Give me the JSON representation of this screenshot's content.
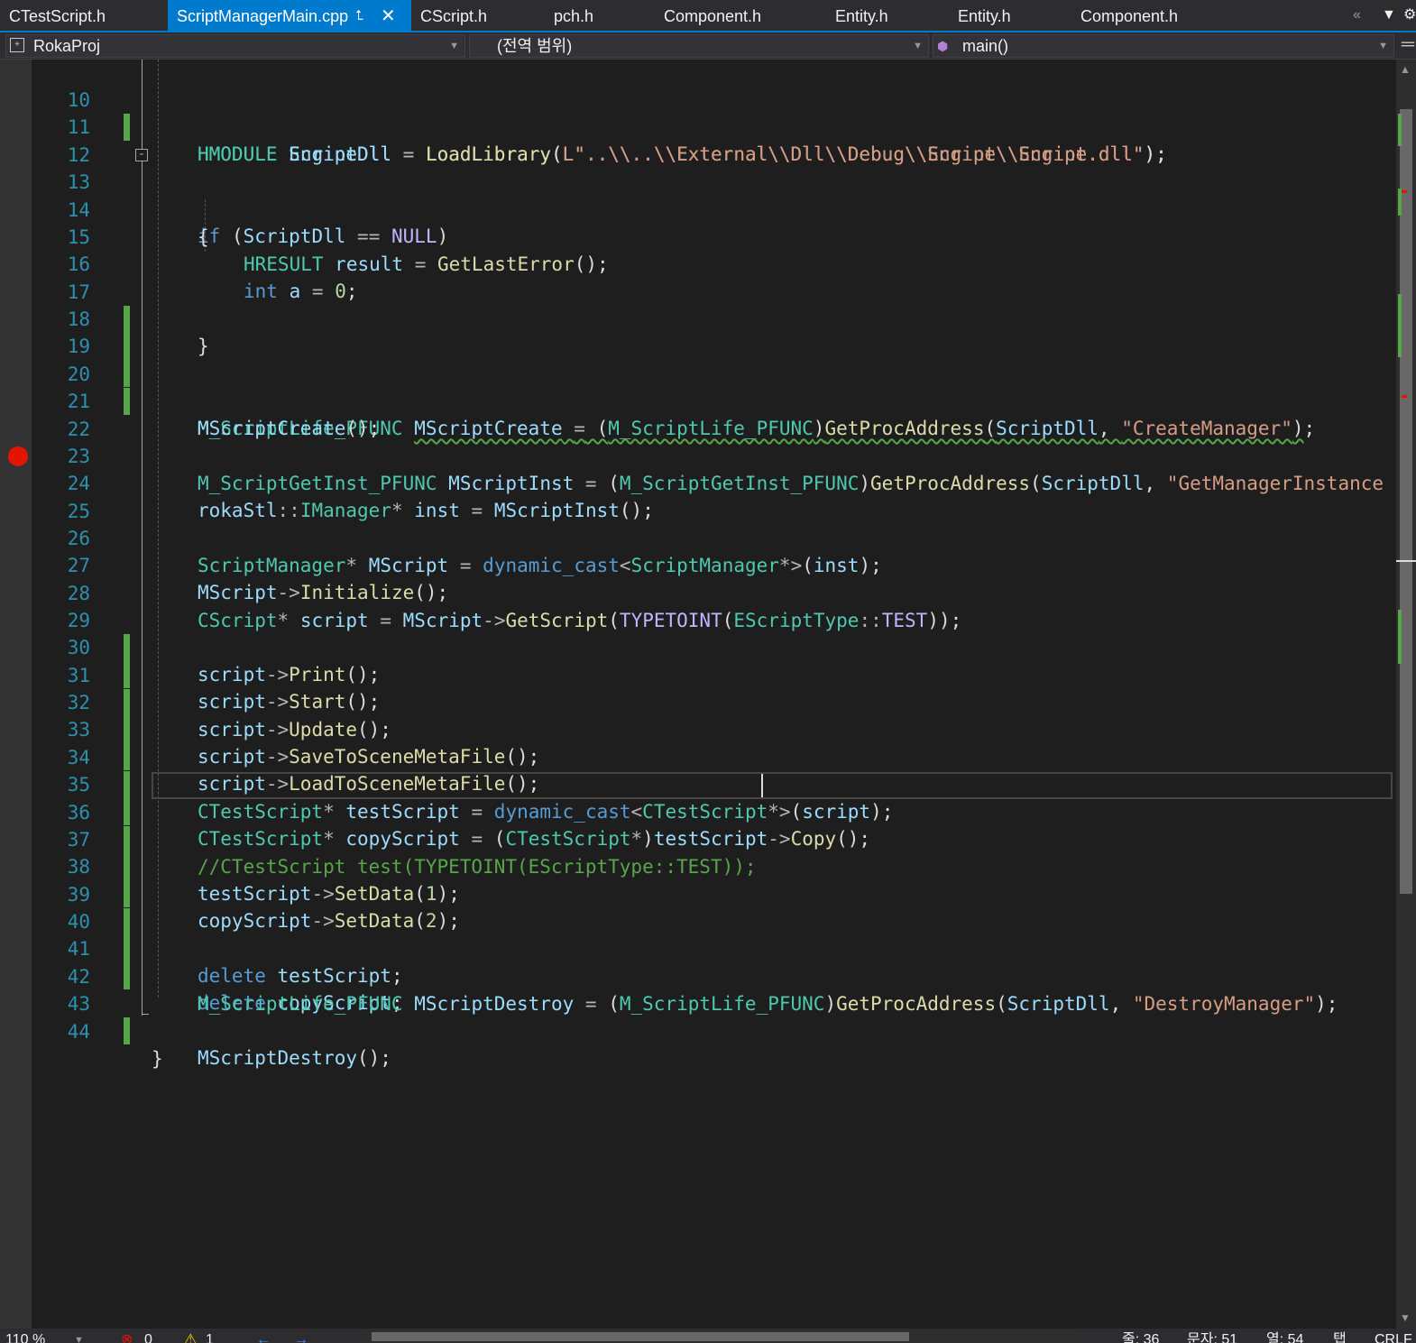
{
  "tabs": [
    {
      "label": "CTestScript.h"
    },
    {
      "label": "ScriptManagerMain.cpp",
      "active": true
    },
    {
      "label": "CScript.h"
    },
    {
      "label": "pch.h"
    },
    {
      "label": "Component.h"
    },
    {
      "label": "Entity.h"
    },
    {
      "label": "Entity.h"
    },
    {
      "label": "Component.h"
    }
  ],
  "tab_icons": {
    "pin": "pin-icon",
    "close": "close-icon",
    "overflow": "double-chevron-left-icon",
    "dropdown": "dropdown-icon",
    "settings": "gear-icon"
  },
  "nav": {
    "project": "RokaProj",
    "scope": "(전역 범위)",
    "member": "main()"
  },
  "editor": {
    "breakpoint_line": "24",
    "cursor_line": "36",
    "lines": [
      {
        "n": "10",
        "code": "HMODULE EngineDll = LoadLibrary(L\"..\\\\..\\\\External\\\\Dll\\\\Debug\\\\Engine\\\\Engine.dll\");"
      },
      {
        "n": "11",
        "code": "HMODULE ScriptDll = LoadLibrary(L\"..\\\\..\\\\External\\\\Dll\\\\Debug\\\\Script\\\\Script.dll\");"
      },
      {
        "n": "12",
        "code": ""
      },
      {
        "n": "13",
        "code": "if (ScriptDll == NULL)"
      },
      {
        "n": "14",
        "code": "{"
      },
      {
        "n": "15",
        "code": "HRESULT result = GetLastError();"
      },
      {
        "n": "16",
        "code": "int a = 0;"
      },
      {
        "n": "17",
        "code": "}"
      },
      {
        "n": "18",
        "code": ""
      },
      {
        "n": "19",
        "code": ""
      },
      {
        "n": "20",
        "code": "M_ScriptLife_PFUNC MScriptCreate = (M_ScriptLife_PFUNC)GetProcAddress(ScriptDll, \"CreateManager\");"
      },
      {
        "n": "21",
        "code": "MScriptCreate();"
      },
      {
        "n": "22",
        "code": ""
      },
      {
        "n": "23",
        "code": "M_ScriptGetInst_PFUNC MScriptInst = (M_ScriptGetInst_PFUNC)GetProcAddress(ScriptDll, \"GetManagerInstance"
      },
      {
        "n": "24",
        "code": "rokaStl::IManager* inst = MScriptInst();"
      },
      {
        "n": "25",
        "code": ""
      },
      {
        "n": "26",
        "code": "ScriptManager* MScript = dynamic_cast<ScriptManager*>(inst);"
      },
      {
        "n": "27",
        "code": "MScript->Initialize();"
      },
      {
        "n": "28",
        "code": "CScript* script = MScript->GetScript(TYPETOINT(EScriptType::TEST));"
      },
      {
        "n": "29",
        "code": "script->Print();"
      },
      {
        "n": "30",
        "code": "script->Start();"
      },
      {
        "n": "31",
        "code": "script->Update();"
      },
      {
        "n": "32",
        "code": "script->SaveToSceneMetaFile();"
      },
      {
        "n": "33",
        "code": "script->LoadToSceneMetaFile();"
      },
      {
        "n": "34",
        "code": "CTestScript* testScript = dynamic_cast<CTestScript*>(script);"
      },
      {
        "n": "35",
        "code": "CTestScript* copyScript = (CTestScript*)testScript->Copy();"
      },
      {
        "n": "36",
        "code": "//CTestScript test(TYPETOINT(EScriptType::TEST));"
      },
      {
        "n": "37",
        "code": "testScript->SetData(1);"
      },
      {
        "n": "38",
        "code": "copyScript->SetData(2);"
      },
      {
        "n": "39",
        "code": ""
      },
      {
        "n": "40",
        "code": "delete testScript;"
      },
      {
        "n": "41",
        "code": "delete copyScript;"
      },
      {
        "n": "42",
        "code": "M_ScriptLife_PFUNC MScriptDestroy = (M_ScriptLife_PFUNC)GetProcAddress(ScriptDll, \"DestroyManager\");"
      },
      {
        "n": "43",
        "code": "MScriptDestroy();"
      },
      {
        "n": "44",
        "code": "}"
      }
    ]
  },
  "status": {
    "zoom": "110 %",
    "errors": "0",
    "warnings": "1",
    "line": "줄: 36",
    "char": "문자: 51",
    "col": "열: 54",
    "tab": "탭",
    "eol": "CRLF"
  },
  "colors": {
    "accent": "#007acc",
    "breakpoint": "#e51400",
    "change_bar": "#57a64a",
    "background": "#1e1e1e"
  }
}
